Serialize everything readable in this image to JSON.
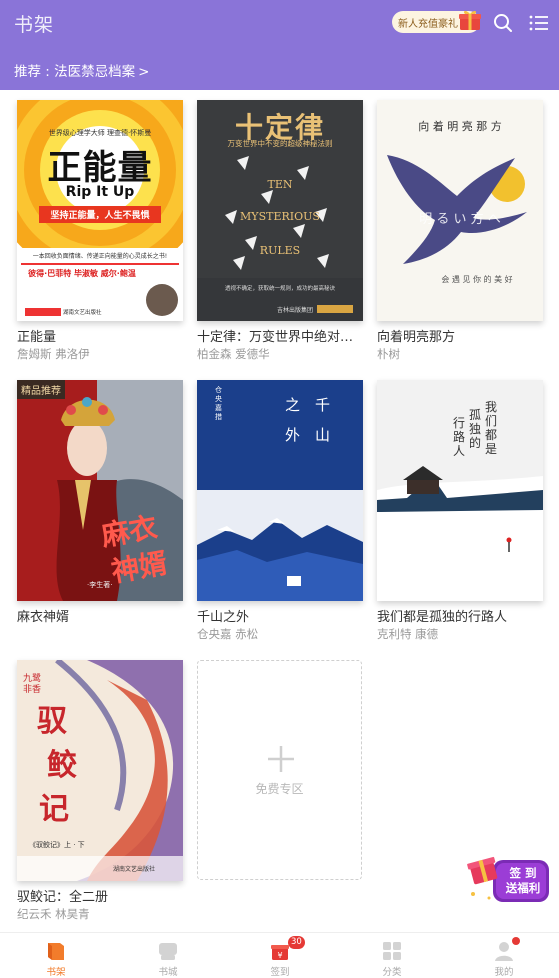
{
  "header": {
    "title": "书架",
    "gift_pill_label": "新人充值豪礼",
    "recommend": "推荐 : 法医禁忌档案",
    "recommend_chevron": ">"
  },
  "colors": {
    "header_bg": "#8a74d8",
    "active_tab": "#f27c2b",
    "badge_red": "#e53935"
  },
  "books": [
    {
      "title": "正能量",
      "authors": "詹姆斯   弗洛伊",
      "badge": "",
      "cover": {
        "lines": [
          "世界级心理学大师 理查德·怀斯曼",
          "正能量",
          "Rip It Up",
          "坚持正能量，人生不畏惧",
          "一本回收负面情绪、传递正向能量的心灵成长之书!",
          "彼得·巴菲特   毕淑敏   威尔·鲍温",
          "湖南文艺出版社"
        ]
      }
    },
    {
      "title": "十定律：万变世界中绝对不…",
      "authors": "柏金森   爱德华",
      "badge": "",
      "cover": {
        "lines": [
          "十定律",
          "万变世界中不变的超级神秘法则",
          "TEN",
          "MYSTERIOUS",
          "RULES",
          "透视不确定，获取统一规则，成功的最高秘诀",
          "吉林出版集团"
        ]
      }
    },
    {
      "title": "向着明亮那方",
      "authors": "朴树",
      "badge": "",
      "cover": {
        "lines": [
          "向 着 明 亮 那 方",
          "明 る い 方 へ",
          "会 遇 见 你 的 美 好"
        ]
      }
    },
    {
      "title": "麻衣神婿",
      "authors": "",
      "badge": "精品推荐",
      "cover": {
        "lines": [
          "麻衣",
          "神婿",
          "·李生著·"
        ]
      }
    },
    {
      "title": "千山之外",
      "authors": "仓央嘉   赤松",
      "badge": "",
      "cover": {
        "lines": [
          "千",
          "山",
          "之",
          "外",
          "仓央嘉措"
        ]
      }
    },
    {
      "title": "我们都是孤独的行路人",
      "authors": "克利特   康德",
      "badge": "",
      "cover": {
        "lines": [
          "我们都是",
          "孤独的",
          "行路人"
        ]
      }
    },
    {
      "title": "驭鲛记：全二册",
      "authors": "纪云禾   林昊青",
      "badge": "",
      "cover": {
        "lines": [
          "驭",
          "鲛",
          "记",
          "九鹭非香",
          "《驭鲛记》上 · 下",
          "湖南文艺出版社"
        ]
      }
    }
  ],
  "free_zone": {
    "label": "免费专区"
  },
  "sign_in": {
    "line1": "签  到",
    "line2": "送福利"
  },
  "bottom_nav": [
    {
      "label": "书架",
      "icon": "bookshelf-icon",
      "active": true,
      "badge": ""
    },
    {
      "label": "书城",
      "icon": "bookstore-icon",
      "active": false,
      "badge": ""
    },
    {
      "label": "签到",
      "icon": "sign-in-gift-icon",
      "active": false,
      "badge": "30"
    },
    {
      "label": "分类",
      "icon": "category-grid-icon",
      "active": false,
      "badge": ""
    },
    {
      "label": "我的",
      "icon": "profile-icon",
      "active": false,
      "badge": "dot"
    }
  ]
}
